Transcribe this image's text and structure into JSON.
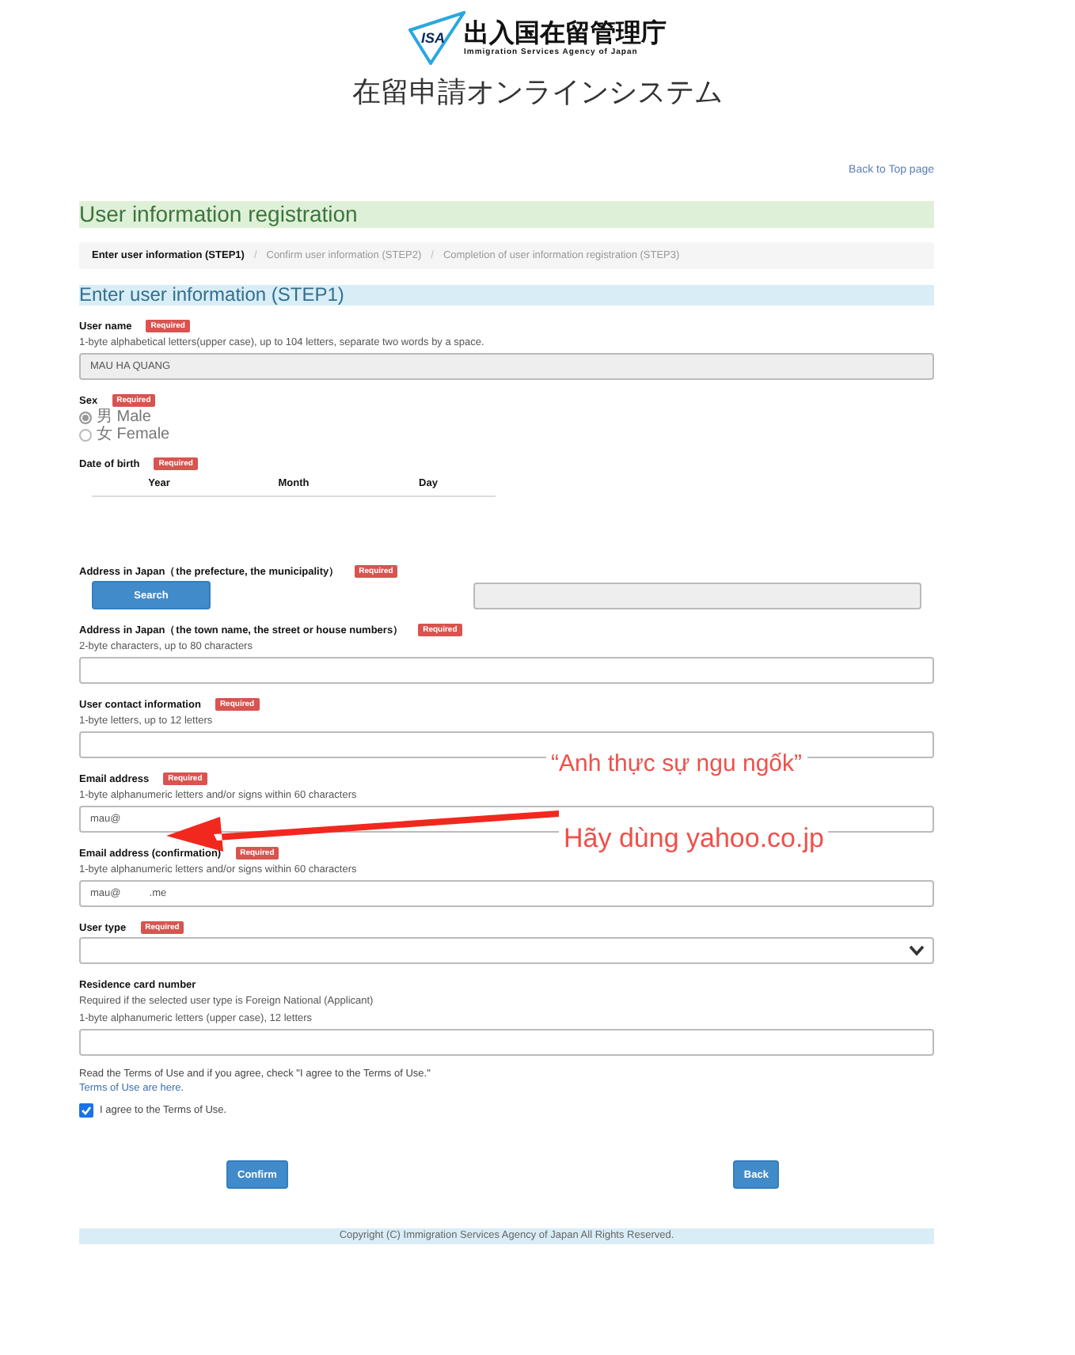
{
  "header": {
    "logo_text": "ISA",
    "agency_name": "出入国在留管理庁",
    "agency_name_en": "Immigration Services Agency of Japan",
    "system_title": "在留申請オンラインシステム"
  },
  "back_link": "Back to Top page",
  "page_title": "User information registration",
  "steps": [
    {
      "label": "Enter user information (STEP1)",
      "selected": true
    },
    {
      "label": "Confirm user information (STEP2)",
      "selected": false
    },
    {
      "label": "Completion of user information registration (STEP3)",
      "selected": false
    }
  ],
  "step_separator": "/",
  "section_title": "Enter user information (STEP1)",
  "fields": [
    {
      "kind": "text",
      "label": "User name",
      "badge": "Required",
      "hints": [
        "1-byte alphabetical letters(upper case), up to 104 letters, separate two words by a space."
      ],
      "value": "MAU HA QUANG",
      "disabled": true
    },
    {
      "kind": "radio",
      "label": "Sex",
      "badge": "Required",
      "options": [
        {
          "label": "男 Male",
          "selected": true
        },
        {
          "label": "女 Female",
          "selected": false
        }
      ]
    },
    {
      "kind": "date",
      "label": "Date of birth",
      "badge": "Required",
      "columns": [
        "Year",
        "Month",
        "Day"
      ]
    },
    {
      "kind": "search",
      "label": "Address in Japan（the prefecture, the municipality）",
      "badge": "Required",
      "button": "Search",
      "disabled": true
    },
    {
      "kind": "text",
      "label": "Address in Japan（the town name, the street or house numbers）",
      "badge": "Required",
      "hints": [
        "2-byte characters, up to 80 characters"
      ],
      "disabled": false
    },
    {
      "kind": "text",
      "label": "User contact information",
      "badge": "Required",
      "hints": [
        "1-byte letters, up to 12 letters"
      ],
      "disabled": false
    },
    {
      "kind": "text",
      "label": "Email address",
      "badge": "Required",
      "hints": [
        "1-byte alphanumeric letters and/or signs within 60 characters"
      ],
      "value": "mau@",
      "disabled": false
    },
    {
      "kind": "text",
      "label": "Email address (confirmation)",
      "badge": "Required",
      "hints": [
        "1-byte alphanumeric letters and/or signs within 60 characters"
      ],
      "value": "mau@          .me",
      "disabled": false
    },
    {
      "kind": "select",
      "label": "User type",
      "badge": "Required"
    },
    {
      "kind": "text",
      "label": "Residence card number",
      "hints": [
        "Required if the selected user type is Foreign National (Applicant)",
        "1-byte alphanumeric letters (upper case), 12 letters"
      ],
      "disabled": false
    }
  ],
  "terms": {
    "text": "Read the Terms of Use and if you agree, check \"I agree to the Terms of Use.\"",
    "link": "Terms of Use are here.",
    "checkbox": {
      "label": "I agree to the Terms of Use.",
      "checked": true
    }
  },
  "buttons": [
    "Confirm",
    "Back"
  ],
  "footer": "Copyright (C) Immigration Services Agency of Japan All Rights Reserved.",
  "annotations": [
    {
      "text": "“Anh thực sự ngu ngốk”"
    },
    {
      "text": "Hãy dùng yahoo.co.jp"
    }
  ]
}
